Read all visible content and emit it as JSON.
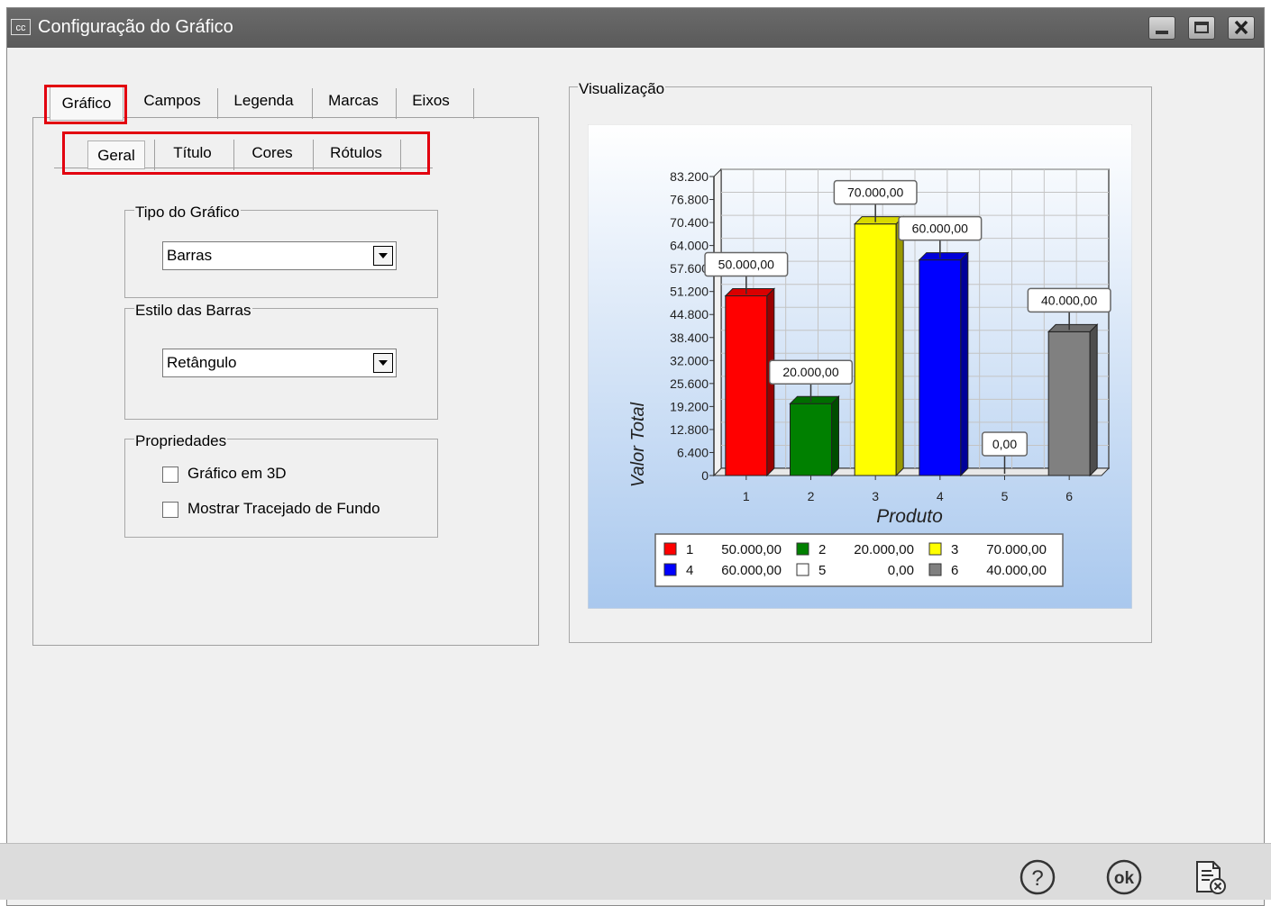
{
  "window": {
    "title": "Configuração do Gráfico",
    "app_icon_text": "cc"
  },
  "tabs": [
    "Gráfico",
    "Campos",
    "Legenda",
    "Marcas",
    "Eixos"
  ],
  "subtabs": [
    "Geral",
    "Título",
    "Cores",
    "Rótulos"
  ],
  "tipo_grafico": {
    "label": "Tipo do Gráfico",
    "value": "Barras"
  },
  "estilo_barras": {
    "label": "Estilo das Barras",
    "value": "Retângulo"
  },
  "propriedades": {
    "label": "Propriedades",
    "items": [
      {
        "label": "Gráfico em 3D",
        "checked": false
      },
      {
        "label": "Mostrar Tracejado de Fundo",
        "checked": false
      }
    ]
  },
  "preview": {
    "label": "Visualização"
  },
  "chart_data": {
    "type": "bar",
    "categories": [
      "1",
      "2",
      "3",
      "4",
      "5",
      "6"
    ],
    "values": [
      50000,
      20000,
      70000,
      60000,
      0,
      40000
    ],
    "value_labels": [
      "50.000,00",
      "20.000,00",
      "70.000,00",
      "60.000,00",
      "0,00",
      "40.000,00"
    ],
    "colors": [
      "#ff0000",
      "#008000",
      "#ffff00",
      "#0000ff",
      "#ffffff",
      "#808080"
    ],
    "xlabel": "Produto",
    "ylabel": "Valor Total",
    "ylim": [
      0,
      83200
    ],
    "yticks": [
      "0",
      "6.400",
      "12.800",
      "19.200",
      "25.600",
      "32.000",
      "38.400",
      "44.800",
      "51.200",
      "57.600",
      "64.000",
      "70.400",
      "76.800",
      "83.200"
    ],
    "legend": [
      {
        "key": "1",
        "value": "50.000,00"
      },
      {
        "key": "2",
        "value": "20.000,00"
      },
      {
        "key": "3",
        "value": "70.000,00"
      },
      {
        "key": "4",
        "value": "60.000,00"
      },
      {
        "key": "5",
        "value": "0,00"
      },
      {
        "key": "6",
        "value": "40.000,00"
      }
    ],
    "legend_position": "bottom",
    "grid": true,
    "style": "3d"
  }
}
